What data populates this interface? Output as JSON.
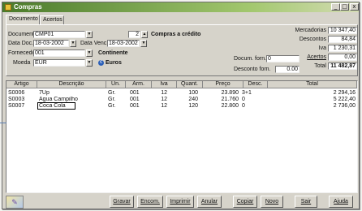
{
  "window": {
    "title": "Compras",
    "controls": [
      "_",
      "□",
      "x"
    ]
  },
  "tabs": [
    {
      "label": "Documento"
    },
    {
      "label": "Acertos"
    }
  ],
  "header": {
    "documento_label": "Documento",
    "documento_value": "CMP01",
    "copies_value": "2",
    "tipo_text": "Compras a crédito",
    "data_doc_label": "Data Doc.",
    "data_doc_value": "18-03-2002",
    "data_venc_label": "Data Venc.",
    "data_venc_value": "18-03-2002",
    "fornecedor_label": "Fornecedor",
    "fornecedor_value": "001",
    "fornecedor_text": "Continente",
    "moeda_label": "Moeda",
    "moeda_value": "EUR",
    "moeda_text": "Euros",
    "docum_forn_label": "Docum. forn.",
    "docum_forn_value": "0",
    "desconto_forn_label": "Desconto forn.",
    "desconto_forn_value": "0.00"
  },
  "totals": {
    "mercadorias_label": "Mercadorias",
    "mercadorias_value": "10 347,40",
    "descontos_label": "Descontos",
    "descontos_value": "84,84",
    "iva_label": "Iva",
    "iva_value": "1 230,31",
    "acertos_label": "Acertos",
    "acertos_value": "0,00",
    "total_label": "Total",
    "total_value": "11 482,87"
  },
  "grid": {
    "columns": [
      "Artigo",
      "Descrição",
      "Un.",
      "Arm.",
      "Iva",
      "Quant.",
      "Preço",
      "Desc.",
      "Total"
    ],
    "rows": [
      {
        "artigo": "S0006",
        "descricao": "7Up",
        "un": "Gr.",
        "arm": "001",
        "iva": "12",
        "quant": "100",
        "preco": "23.890",
        "desc": "3+1",
        "total": "2 294,16"
      },
      {
        "artigo": "S0003",
        "descricao": "Agua Campilho",
        "un": "Gr.",
        "arm": "001",
        "iva": "12",
        "quant": "240",
        "preco": "21.760",
        "desc": "0",
        "total": "5 222,40"
      },
      {
        "artigo": "S0007",
        "descricao": "Coca Cola",
        "un": "Gr.",
        "arm": "001",
        "iva": "12",
        "quant": "120",
        "preco": "22.800",
        "desc": "0",
        "total": "2 736,00"
      }
    ]
  },
  "toolbar": {
    "buttons": [
      "Gravar",
      "Encom.",
      "Imprimir",
      "Anular",
      "Copiar",
      "Novo",
      "Sair",
      "Ajuda"
    ]
  },
  "icons": {
    "window_icon": "app-icon",
    "euro_icon": "euro-icon",
    "logo_icon": "app-logo-icon"
  },
  "colors": {
    "titlebar_start": "#4a7a2a",
    "titlebar_end": "#d4dcb4",
    "face": "#d6d3ca"
  }
}
